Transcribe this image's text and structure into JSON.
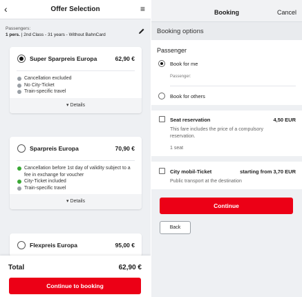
{
  "left": {
    "title": "Offer Selection",
    "back_glyph": "‹",
    "menu_glyph": "≡",
    "passengers_label": "Passengers:",
    "passengers_count": "1 pers.",
    "passengers_detail": " | 2nd Class - 31 years - Without BahnCard",
    "offers": [
      {
        "name": "Super Sparpreis Europa",
        "price": "62,90 €",
        "selected": true,
        "features": [
          {
            "text": "Cancellation excluded",
            "status": "grey"
          },
          {
            "text": "No City-Ticket",
            "status": "grey"
          },
          {
            "text": "Train-specific travel",
            "status": "grey"
          }
        ],
        "details_label": "Details"
      },
      {
        "name": "Sparpreis Europa",
        "price": "70,90 €",
        "selected": false,
        "features": [
          {
            "text": "Cancellation before 1st day of validity subject to a fee in exchange for voucher",
            "status": "green"
          },
          {
            "text": "City-Ticket included",
            "status": "green"
          },
          {
            "text": "Train-specific travel",
            "status": "grey"
          }
        ],
        "details_label": "Details"
      },
      {
        "name": "Flexpreis Europa",
        "price": "95,00 €",
        "selected": false
      }
    ],
    "total_label": "Total",
    "total_value": "62,90 €",
    "continue_label": "Continue to booking"
  },
  "right": {
    "title": "Booking",
    "cancel_label": "Cancel",
    "section_title": "Booking options",
    "passenger_label": "Passenger",
    "book_for_me": "Book for me",
    "passenger_sub": "Passenger:",
    "book_for_others": "Book for others",
    "seat": {
      "title": "Seat reservation",
      "price": "4,50 EUR",
      "desc": "This fare includes the price of a compulsory reservation.",
      "count": "1 seat"
    },
    "city": {
      "title": "City mobil-Ticket",
      "price": "starting from 3,70 EUR",
      "desc": "Public transport at the destination"
    },
    "continue_label": "Continue",
    "back_label": "Back"
  },
  "colors": {
    "accent": "#ec0016",
    "ok": "#3aa935",
    "neutral": "#9aa0a6"
  }
}
